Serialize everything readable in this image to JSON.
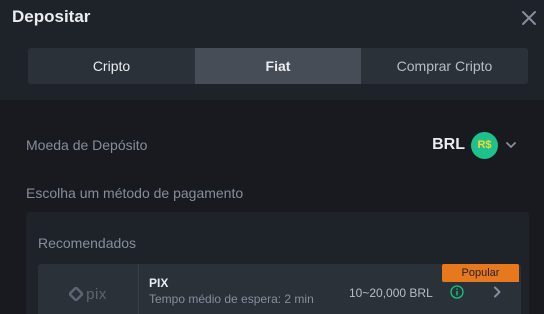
{
  "dialog": {
    "title": "Depositar"
  },
  "tabs": [
    {
      "label": "Cripto"
    },
    {
      "label": "Fiat"
    },
    {
      "label": "Comprar Cripto"
    }
  ],
  "active_tab": "Fiat",
  "currency": {
    "label": "Moeda de Depósito",
    "code": "BRL",
    "symbol": "R$",
    "badge_color": "#1dc18c"
  },
  "payment": {
    "prompt": "Escolha um método de pagamento",
    "section_title": "Recomendados",
    "methods": [
      {
        "logo_text": "pix",
        "name": "PIX",
        "wait": "Tempo médio de espera: 2 min",
        "range": "10~20,000 BRL",
        "badge": "Popular"
      }
    ]
  },
  "colors": {
    "accent_orange": "#e8781e",
    "info_green": "#0ecb81"
  }
}
